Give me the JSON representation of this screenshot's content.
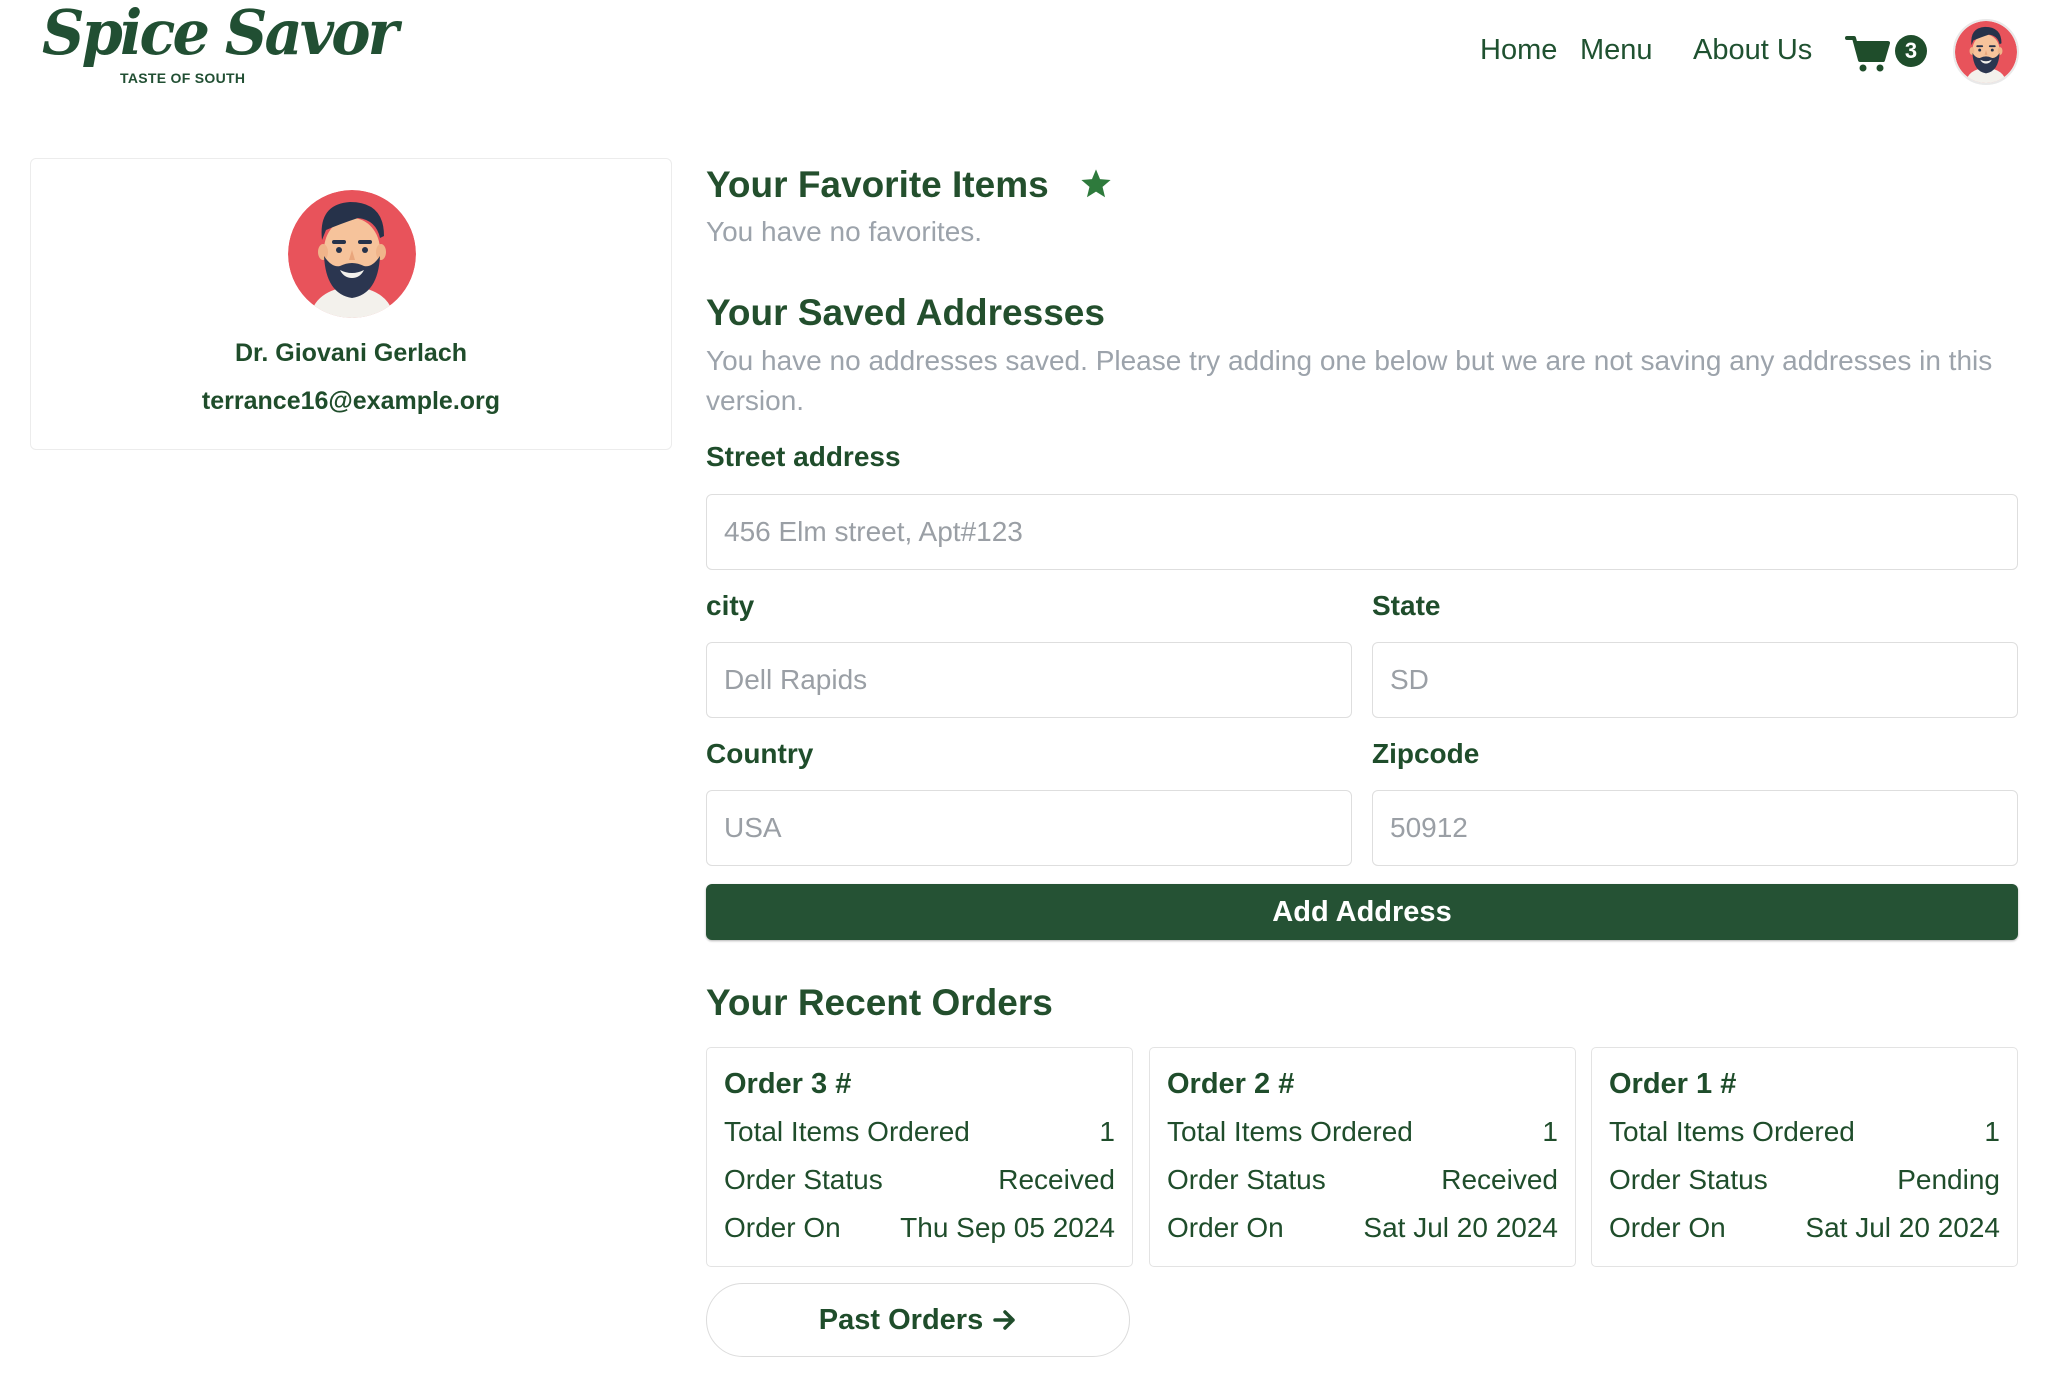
{
  "brand": {
    "name": "Spice Savor",
    "tagline": "TASTE OF SOUTH"
  },
  "nav": {
    "home": "Home",
    "menu": "Menu",
    "about": "About Us",
    "cart_count": "3"
  },
  "profile": {
    "name": "Dr. Giovani Gerlach",
    "email": "terrance16@example.org"
  },
  "favorites": {
    "title": "Your Favorite Items",
    "empty_text": "You have no favorites."
  },
  "addresses": {
    "title": "Your Saved Addresses",
    "empty_text": "You have no addresses saved. Please try adding one below but we are not saving any addresses in this version.",
    "street_label": "Street address",
    "street_placeholder": "456 Elm street, Apt#123",
    "city_label": "city",
    "city_placeholder": "Dell Rapids",
    "state_label": "State",
    "state_placeholder": "SD",
    "country_label": "Country",
    "country_placeholder": "USA",
    "zip_label": "Zipcode",
    "zip_placeholder": "50912",
    "add_button": "Add Address"
  },
  "orders": {
    "title": "Your Recent Orders",
    "items_label": "Total Items Ordered",
    "status_label": "Order Status",
    "date_label": "Order On",
    "list": [
      {
        "title": "Order 3 #",
        "items": "1",
        "status": "Received",
        "date": "Thu Sep 05 2024"
      },
      {
        "title": "Order 2 #",
        "items": "1",
        "status": "Received",
        "date": "Sat Jul 20 2024"
      },
      {
        "title": "Order 1 #",
        "items": "1",
        "status": "Pending",
        "date": "Sat Jul 20 2024"
      }
    ],
    "past_button": "Past Orders"
  },
  "colors": {
    "primary": "#255234",
    "star": "#2e7a3c",
    "muted": "#9ca3ab",
    "avatar_bg": "#e8535b"
  }
}
